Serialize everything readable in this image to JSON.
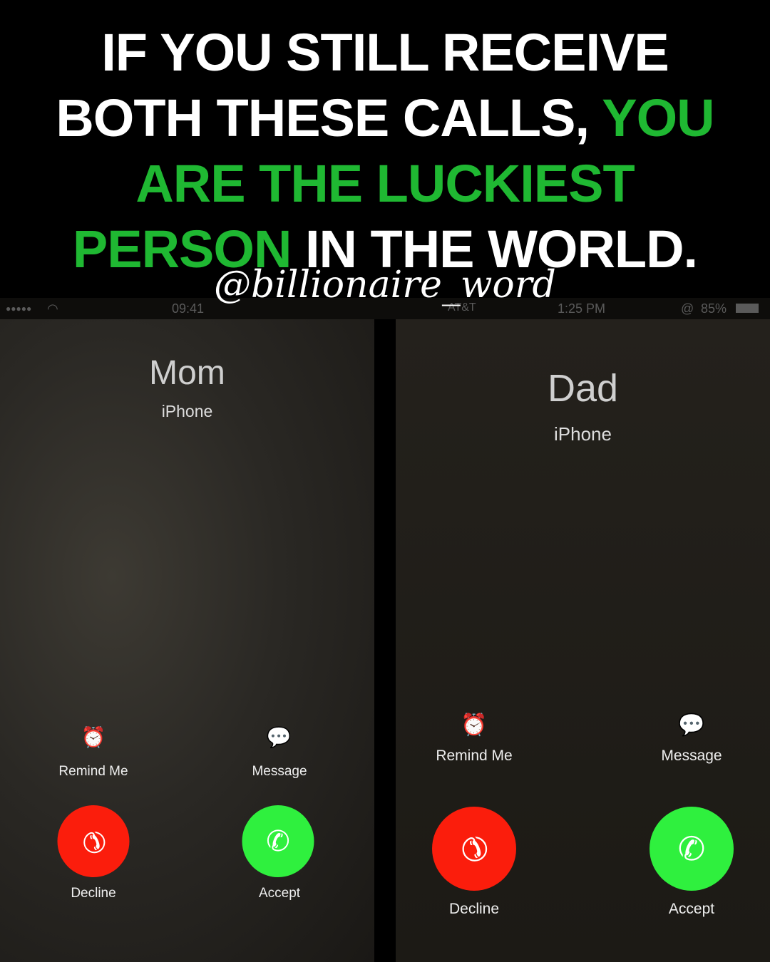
{
  "headline": {
    "line1": "IF YOU STILL RECEIVE",
    "line2_white": "BOTH THESE CALLS, ",
    "line2_green": "YOU",
    "line3_green": "ARE THE LUCKIEST",
    "line4_green": "PERSON",
    "line4_white": " IN THE WORLD."
  },
  "watermark": "@billionaire_word",
  "colors": {
    "accent_green": "#1fb832",
    "decline": "#fb1d0c",
    "accept": "#2ff03e"
  },
  "status": {
    "signal": "●●●●●",
    "left_time": "09:41",
    "carrier": "AT&T",
    "right_time": "1:25 PM",
    "battery": "85%"
  },
  "left_call": {
    "name": "Mom",
    "device": "iPhone",
    "remind": "Remind Me",
    "message": "Message",
    "decline": "Decline",
    "accept": "Accept"
  },
  "right_call": {
    "name": "Dad",
    "device": "iPhone",
    "remind": "Remind Me",
    "message": "Message",
    "decline": "Decline",
    "accept": "Accept"
  }
}
